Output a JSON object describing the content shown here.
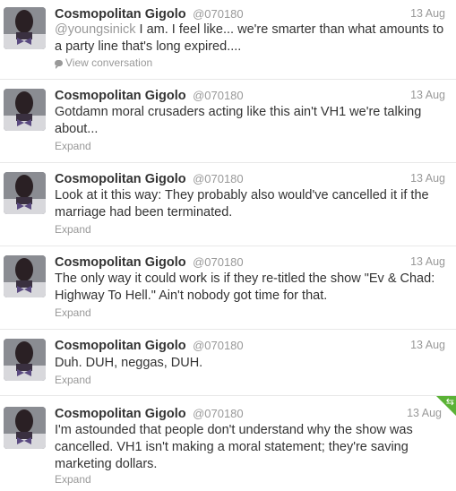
{
  "tweets": [
    {
      "fullname": "Cosmopolitan Gigolo",
      "username": "@070180",
      "time": "13 Aug",
      "mention": "@youngsinick",
      "text": " I am. I feel like... we're smarter than what amounts to a party line that's long expired....",
      "action": "View conversation"
    },
    {
      "fullname": "Cosmopolitan Gigolo",
      "username": "@070180",
      "time": "13 Aug",
      "text": "Gotdamn moral crusaders acting like this ain't VH1 we're talking about...",
      "action": "Expand"
    },
    {
      "fullname": "Cosmopolitan Gigolo",
      "username": "@070180",
      "time": "13 Aug",
      "text": "Look at it this way: They probably also would've cancelled it if the marriage had been terminated.",
      "action": "Expand"
    },
    {
      "fullname": "Cosmopolitan Gigolo",
      "username": "@070180",
      "time": "13 Aug",
      "text": "The only way it could work is if they re-titled the show \"Ev & Chad: Highway To Hell.\" Ain't nobody got time for that.",
      "action": "Expand"
    },
    {
      "fullname": "Cosmopolitan Gigolo",
      "username": "@070180",
      "time": "13 Aug",
      "text": "Duh. DUH, neggas, DUH.",
      "action": "Expand"
    },
    {
      "fullname": "Cosmopolitan Gigolo",
      "username": "@070180",
      "time": "13 Aug",
      "text": "I'm astounded that people don't understand why the show was cancelled. VH1 isn't making a moral statement; they're saving marketing dollars.",
      "action": "Expand",
      "retweeted": true
    }
  ],
  "icons": {
    "conversation": "speech-bubble-icon",
    "retweet": "retweet-icon"
  },
  "colors": {
    "name": "#333333",
    "meta": "#999999",
    "retweet_badge": "#5bb236"
  }
}
